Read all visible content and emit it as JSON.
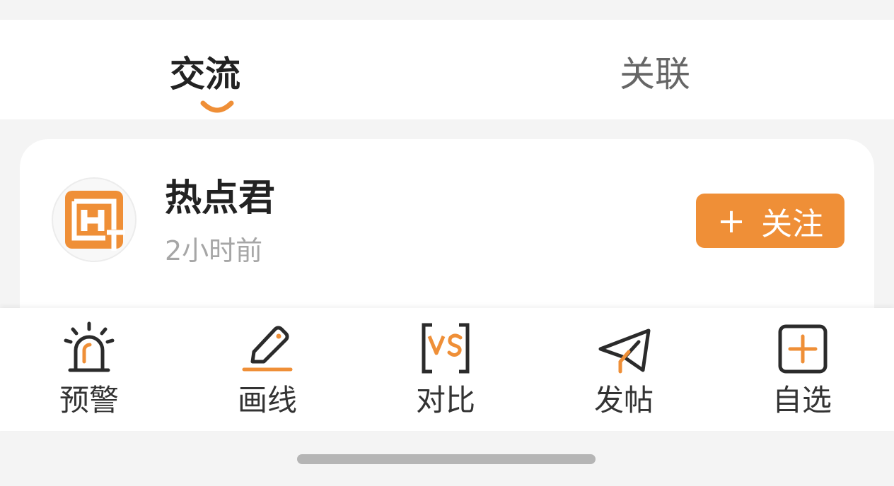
{
  "tabs": [
    {
      "label": "交流",
      "active": true
    },
    {
      "label": "关联",
      "active": false
    }
  ],
  "post": {
    "author_name": "热点君",
    "time": "2小时前",
    "avatar_icon": "logo-h-icon",
    "follow": {
      "plus": "+",
      "label": "关注"
    }
  },
  "toolbar": {
    "items": [
      {
        "label": "预警",
        "icon": "alarm-light-icon"
      },
      {
        "label": "画线",
        "icon": "pencil-icon"
      },
      {
        "label": "对比",
        "icon": "vs-compare-icon"
      },
      {
        "label": "发帖",
        "icon": "paper-plane-icon"
      },
      {
        "label": "自选",
        "icon": "add-square-icon"
      }
    ]
  },
  "colors": {
    "accent": "#ef8f37",
    "text_primary": "#222222",
    "text_secondary": "#a6a6a6",
    "background": "#f4f4f4"
  }
}
